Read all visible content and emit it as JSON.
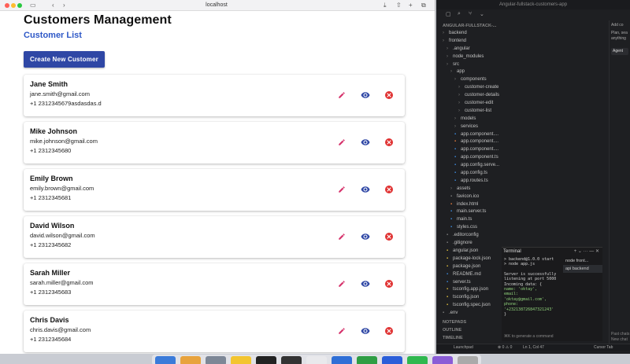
{
  "browser": {
    "url": "localhost"
  },
  "app": {
    "title": "Customers Management",
    "subtitle": "Customer List",
    "create_button": "Create New Customer",
    "customers": [
      {
        "name": "Jane Smith",
        "email": "jane.smith@gmail.com",
        "phone": "+1 2312345679asdasdas.d"
      },
      {
        "name": "Mike Johnson",
        "email": "mike.johnson@gmail.com",
        "phone": "+1 2312345680"
      },
      {
        "name": "Emily Brown",
        "email": "emily.brown@gmail.com",
        "phone": "+1 2312345681"
      },
      {
        "name": "David Wilson",
        "email": "david.wilson@gmail.com",
        "phone": "+1 2312345682"
      },
      {
        "name": "Sarah Miller",
        "email": "sarah.miller@gmail.com",
        "phone": "+1 2312345683"
      },
      {
        "name": "Chris Davis",
        "email": "chris.davis@gmail.com",
        "phone": "+1 2312345684"
      }
    ],
    "icons": {
      "edit": "pencil-icon",
      "view": "eye-icon",
      "delete": "close-circle-icon"
    },
    "colors": {
      "accent": "#2f47a5",
      "subtitle": "#2e58c7",
      "edit": "#d6336c",
      "view": "#2f47a5",
      "delete": "#e03131"
    }
  },
  "editor": {
    "window_title": "Angular-fullstack-customers-app",
    "explorer_root": "ANGULAR-FULLSTACK-...",
    "tree": [
      {
        "label": "backend",
        "type": "folder",
        "depth": 0
      },
      {
        "label": "frontend",
        "type": "folder",
        "depth": 0
      },
      {
        "label": ".angular",
        "type": "folder",
        "depth": 1
      },
      {
        "label": "node_modules",
        "type": "folder",
        "depth": 1
      },
      {
        "label": "src",
        "type": "folder",
        "depth": 1
      },
      {
        "label": "app",
        "type": "folder",
        "depth": 2
      },
      {
        "label": "components",
        "type": "folder",
        "depth": 3
      },
      {
        "label": "customer-create",
        "type": "folder",
        "depth": 4
      },
      {
        "label": "customer-details",
        "type": "folder",
        "depth": 4
      },
      {
        "label": "customer-edit",
        "type": "folder",
        "depth": 4
      },
      {
        "label": "customer-list",
        "type": "folder",
        "depth": 4
      },
      {
        "label": "models",
        "type": "folder",
        "depth": 3
      },
      {
        "label": "services",
        "type": "folder",
        "depth": 3
      },
      {
        "label": "app.component....",
        "type": "css",
        "depth": 3
      },
      {
        "label": "app.component....",
        "type": "html",
        "depth": 3
      },
      {
        "label": "app.component....",
        "type": "ts",
        "depth": 3
      },
      {
        "label": "app.component.ts",
        "type": "ts",
        "depth": 3
      },
      {
        "label": "app.config.serve...",
        "type": "ts",
        "depth": 3
      },
      {
        "label": "app.config.ts",
        "type": "ts",
        "depth": 3
      },
      {
        "label": "app.routes.ts",
        "type": "ts",
        "depth": 3
      },
      {
        "label": "assets",
        "type": "folder",
        "depth": 2
      },
      {
        "label": "favicon.ico",
        "type": "file",
        "depth": 2
      },
      {
        "label": "index.html",
        "type": "html",
        "depth": 2
      },
      {
        "label": "main.server.ts",
        "type": "ts",
        "depth": 2
      },
      {
        "label": "main.ts",
        "type": "ts",
        "depth": 2
      },
      {
        "label": "styles.css",
        "type": "css",
        "depth": 2
      },
      {
        "label": ".editorconfig",
        "type": "file",
        "depth": 1
      },
      {
        "label": ".gitignore",
        "type": "file",
        "depth": 1
      },
      {
        "label": "angular.json",
        "type": "json",
        "depth": 1
      },
      {
        "label": "package-lock.json",
        "type": "json",
        "depth": 1
      },
      {
        "label": "package.json",
        "type": "json",
        "depth": 1
      },
      {
        "label": "README.md",
        "type": "md",
        "depth": 1
      },
      {
        "label": "server.ts",
        "type": "ts",
        "depth": 1
      },
      {
        "label": "tsconfig.app.json",
        "type": "json",
        "depth": 1
      },
      {
        "label": "tsconfig.json",
        "type": "json",
        "depth": 1
      },
      {
        "label": "tsconfig.spec.json",
        "type": "json",
        "depth": 1
      },
      {
        "label": ".env",
        "type": "file",
        "depth": 0
      }
    ],
    "sections": [
      "NOTEPADS",
      "OUTLINE",
      "TIMELINE"
    ],
    "terminal": {
      "title": "Terminal",
      "lines": [
        "> backend@1.0.0 start",
        "> node app.js",
        "",
        "Server is successfully listening at port 5000",
        "Incoming data: {",
        "  name: 'oktay',",
        "  email: 'oktay@gmail.com',",
        "  phone: '+232138726847321243'",
        "}"
      ],
      "tabs": [
        "node front...",
        "api backend"
      ],
      "hint": "⌘K to generate a command"
    },
    "chat": {
      "add_label": "Add co",
      "placeholder_1": "Plan, sea",
      "placeholder_2": "anything",
      "agent_label": "Agent",
      "past_chats": "Past chats",
      "new_chat": "New chat"
    },
    "status": {
      "launchpad": "Launchpad",
      "counts": "⊗ 0 ⚠ 0",
      "position": "Ln 1, Col 47",
      "tab": "Cursor Tab"
    }
  }
}
